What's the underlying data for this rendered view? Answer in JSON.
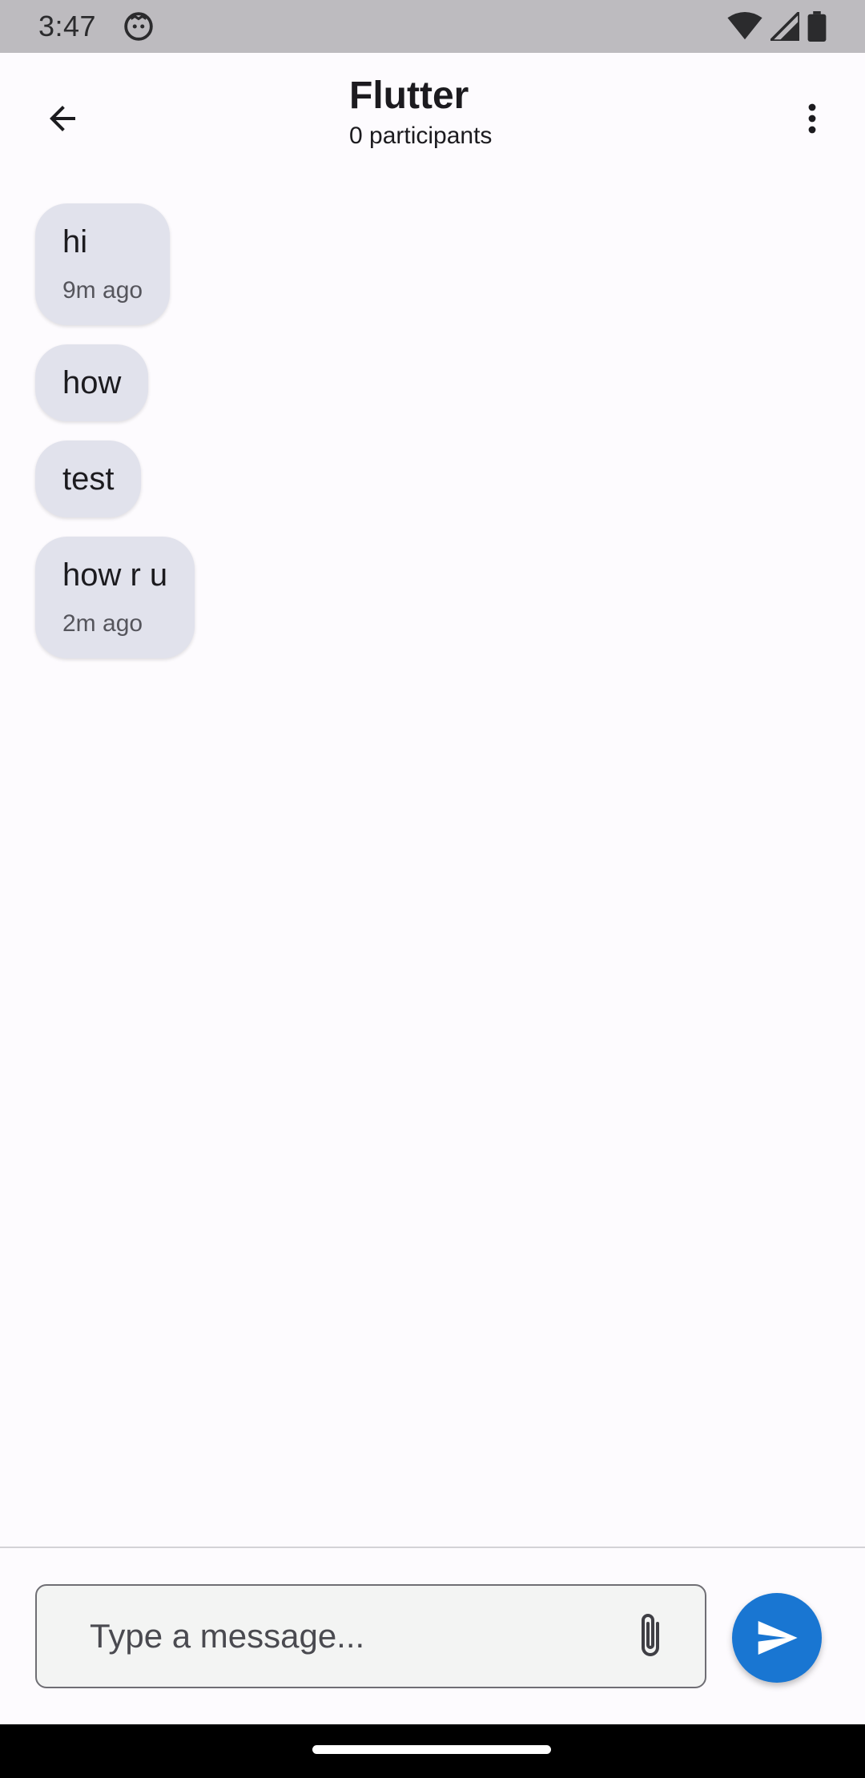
{
  "status_bar": {
    "time": "3:47"
  },
  "header": {
    "title": "Flutter",
    "subtitle": "0 participants"
  },
  "messages": [
    {
      "text": "hi",
      "time": "9m ago"
    },
    {
      "text": "how",
      "time": ""
    },
    {
      "text": "test",
      "time": ""
    },
    {
      "text": "how r u",
      "time": "2m ago"
    }
  ],
  "composer": {
    "placeholder": "Type a message..."
  },
  "colors": {
    "accent": "#1976d2",
    "bubble": "#e1e2ec",
    "background": "#fdfbfe"
  },
  "icons": {
    "back": "arrow-back-icon",
    "menu": "more-vert-icon",
    "attach": "paperclip-icon",
    "send": "send-icon"
  }
}
